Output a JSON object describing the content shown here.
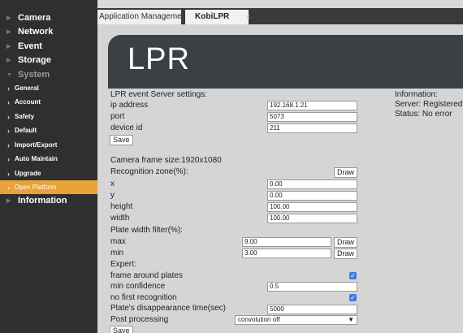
{
  "sidebar": {
    "top_items": [
      {
        "label": "Camera"
      },
      {
        "label": "Network"
      },
      {
        "label": "Event"
      },
      {
        "label": "Storage"
      },
      {
        "label": "System"
      }
    ],
    "sub_items": [
      {
        "label": "General"
      },
      {
        "label": "Account"
      },
      {
        "label": "Safety"
      },
      {
        "label": "Default"
      },
      {
        "label": "Import/Export"
      },
      {
        "label": "Auto Maintain"
      },
      {
        "label": "Upgrade"
      },
      {
        "label": "Open Platform"
      }
    ],
    "bottom_item": {
      "label": "Information"
    }
  },
  "tabs": [
    {
      "label": "Application Management"
    },
    {
      "label": "KobiLPR",
      "close": "×"
    }
  ],
  "banner": {
    "title": "LPR"
  },
  "server": {
    "heading": "LPR event Server settings:",
    "ip_label": "ip address",
    "ip_value": "192.168.1.21",
    "port_label": "port",
    "port_value": "5073",
    "device_label": "device id",
    "device_value": "211",
    "save": "Save"
  },
  "info": {
    "heading": "Information:",
    "server": "Server: Registered",
    "status": "Status: No error"
  },
  "frame": {
    "size": "Camera frame size:1920x1080",
    "zone_heading": "Recognition zone(%):",
    "draw": "Draw",
    "x_label": "x",
    "x_value": "0.00",
    "y_label": "y",
    "y_value": "0.00",
    "height_label": "height",
    "height_value": "100.00",
    "width_label": "width",
    "width_value": "100.00"
  },
  "plate": {
    "heading": "Plate width filter(%):",
    "max_label": "max",
    "max_value": "9.00",
    "min_label": "min",
    "min_value": "3.00",
    "draw": "Draw"
  },
  "expert": {
    "heading": "Expert:",
    "frame_around_label": "frame around plates",
    "frame_around_checked": true,
    "min_conf_label": "min confidence",
    "min_conf_value": "0.5",
    "no_first_label": "no first recognition",
    "no_first_checked": true,
    "disappear_label": "Plate's disappearance time(sec)",
    "disappear_value": "5000",
    "post_label": "Post processing",
    "post_value": "convolution off",
    "save": "Save"
  },
  "colors": {
    "accent": "#e8a23a",
    "sidebar_bg": "#2f2f2f",
    "banner_bg": "#3b4045",
    "checkbox": "#3b7ce0"
  }
}
